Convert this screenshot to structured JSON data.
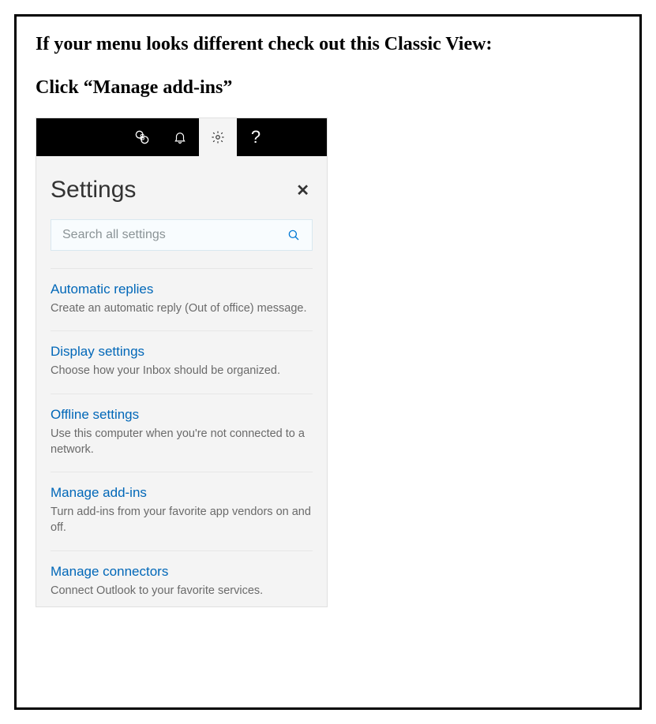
{
  "doc": {
    "heading": "If your menu looks different check out this Classic View:",
    "subheading": "Click “Manage add-ins”"
  },
  "panel": {
    "title": "Settings",
    "close": "✕",
    "search_placeholder": "Search all settings"
  },
  "items": [
    {
      "title": "Automatic replies",
      "desc": "Create an automatic reply (Out of office) message."
    },
    {
      "title": "Display settings",
      "desc": "Choose how your Inbox should be organized."
    },
    {
      "title": "Offline settings",
      "desc": "Use this computer when you're not connected to a network."
    },
    {
      "title": "Manage add-ins",
      "desc": "Turn add-ins from your favorite app vendors on and off."
    },
    {
      "title": "Manage connectors",
      "desc": "Connect Outlook to your favorite services."
    }
  ]
}
